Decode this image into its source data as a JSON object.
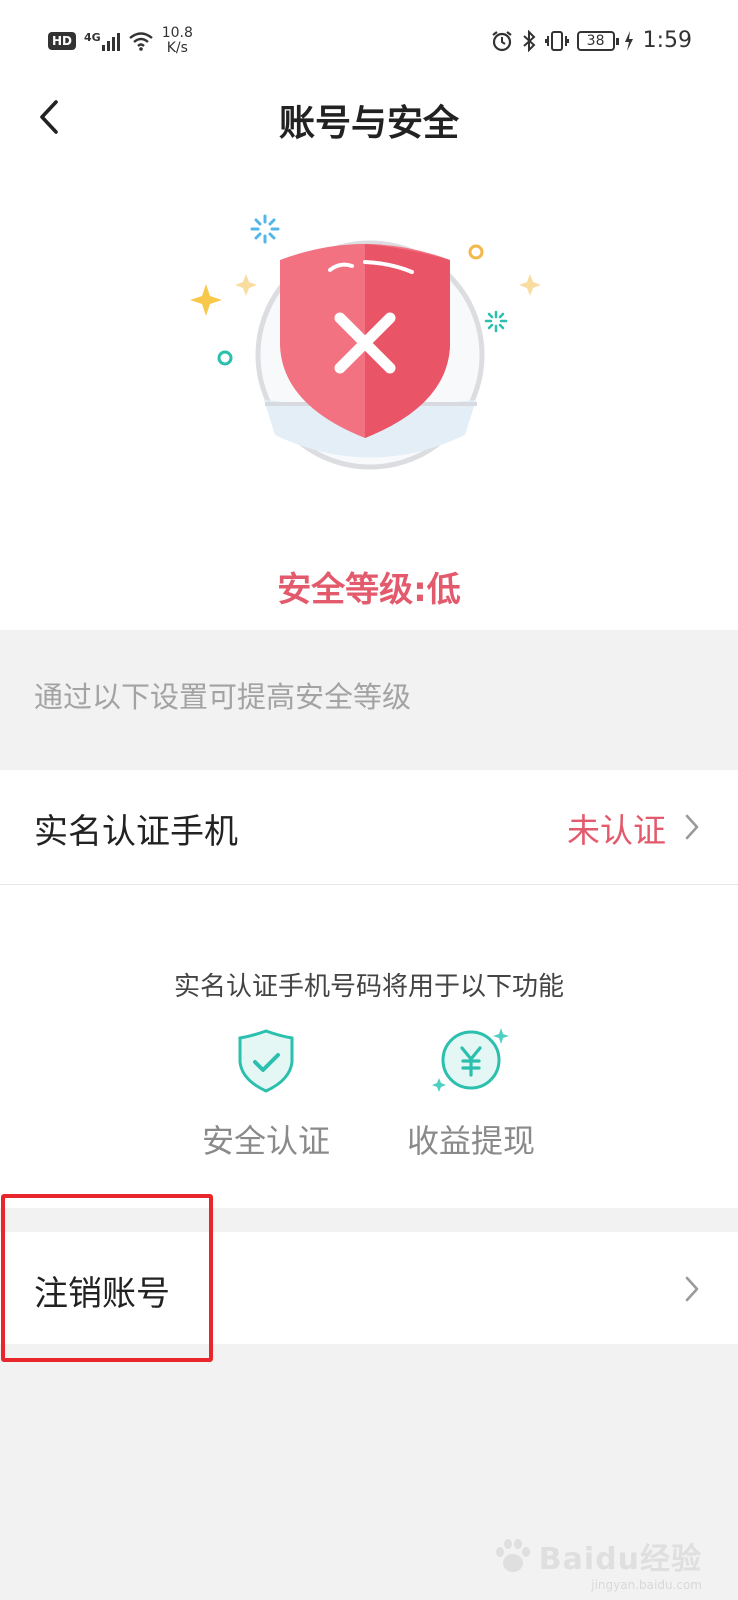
{
  "status_bar": {
    "hd": "HD",
    "network": "4G",
    "speed_value": "10.8",
    "speed_unit": "K/s",
    "battery": "38",
    "time": "1:59"
  },
  "header": {
    "title": "账号与安全"
  },
  "security": {
    "level_text": "安全等级:低",
    "hint": "通过以下设置可提高安全等级"
  },
  "phone_verification": {
    "label": "实名认证手机",
    "status": "未认证",
    "description": "实名认证手机号码将用于以下功能",
    "features": [
      {
        "label": "安全认证",
        "icon": "shield-check-icon"
      },
      {
        "label": "收益提现",
        "icon": "yuan-coin-icon"
      }
    ]
  },
  "account_cancel": {
    "label": "注销账号"
  },
  "watermark": {
    "text": "Baidu经验",
    "sub": "jingyan.baidu.com"
  },
  "colors": {
    "accent_red": "#e25a6b",
    "teal": "#2bbfae",
    "highlight_box": "#e8262b"
  }
}
